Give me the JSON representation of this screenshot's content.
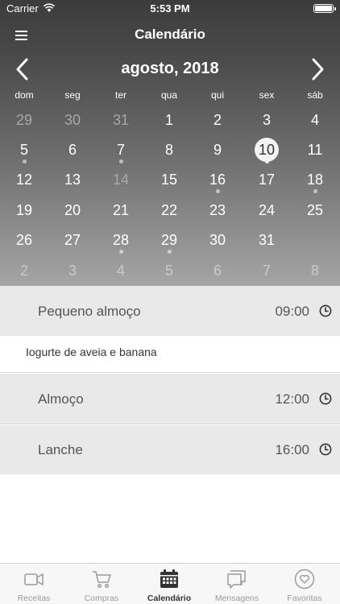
{
  "status_bar": {
    "carrier": "Carrier",
    "time": "5:53 PM"
  },
  "nav": {
    "title": "Calendário",
    "menu_icon": "hamburger-icon"
  },
  "calendar": {
    "month_label": "agosto, 2018",
    "prev_icon": "chevron-left-icon",
    "next_icon": "chevron-right-icon",
    "weekdays": [
      "dom",
      "seg",
      "ter",
      "qua",
      "qui",
      "sex",
      "sáb"
    ],
    "weeks": [
      [
        "29",
        "30",
        "31",
        "1",
        "2",
        "3",
        "4"
      ],
      [
        "5",
        "6",
        "7",
        "8",
        "9",
        "10",
        "11"
      ],
      [
        "12",
        "13",
        "14",
        "15",
        "16",
        "17",
        "18"
      ],
      [
        "19",
        "20",
        "21",
        "22",
        "23",
        "24",
        "25"
      ],
      [
        "26",
        "27",
        "28",
        "29",
        "30",
        "31",
        ""
      ],
      [
        "2",
        "3",
        "4",
        "5",
        "6",
        "7",
        "8"
      ]
    ],
    "selected_day": "10",
    "accent_color": "#f2f2f2"
  },
  "meals": [
    {
      "name": "Pequeno almoço",
      "time": "09:00",
      "note": "Iogurte de aveia e banana"
    },
    {
      "name": "Almoço",
      "time": "12:00"
    },
    {
      "name": "Lanche",
      "time": "16:00"
    }
  ],
  "tabs": [
    {
      "label": "Receitas",
      "icon": "video-camera-icon",
      "active": false
    },
    {
      "label": "Compras",
      "icon": "shopping-cart-icon",
      "active": false
    },
    {
      "label": "Calendário",
      "icon": "calendar-icon",
      "active": true
    },
    {
      "label": "Mensagens",
      "icon": "chat-bubbles-icon",
      "active": false
    },
    {
      "label": "Favoritas",
      "icon": "heart-icon",
      "active": false
    }
  ]
}
